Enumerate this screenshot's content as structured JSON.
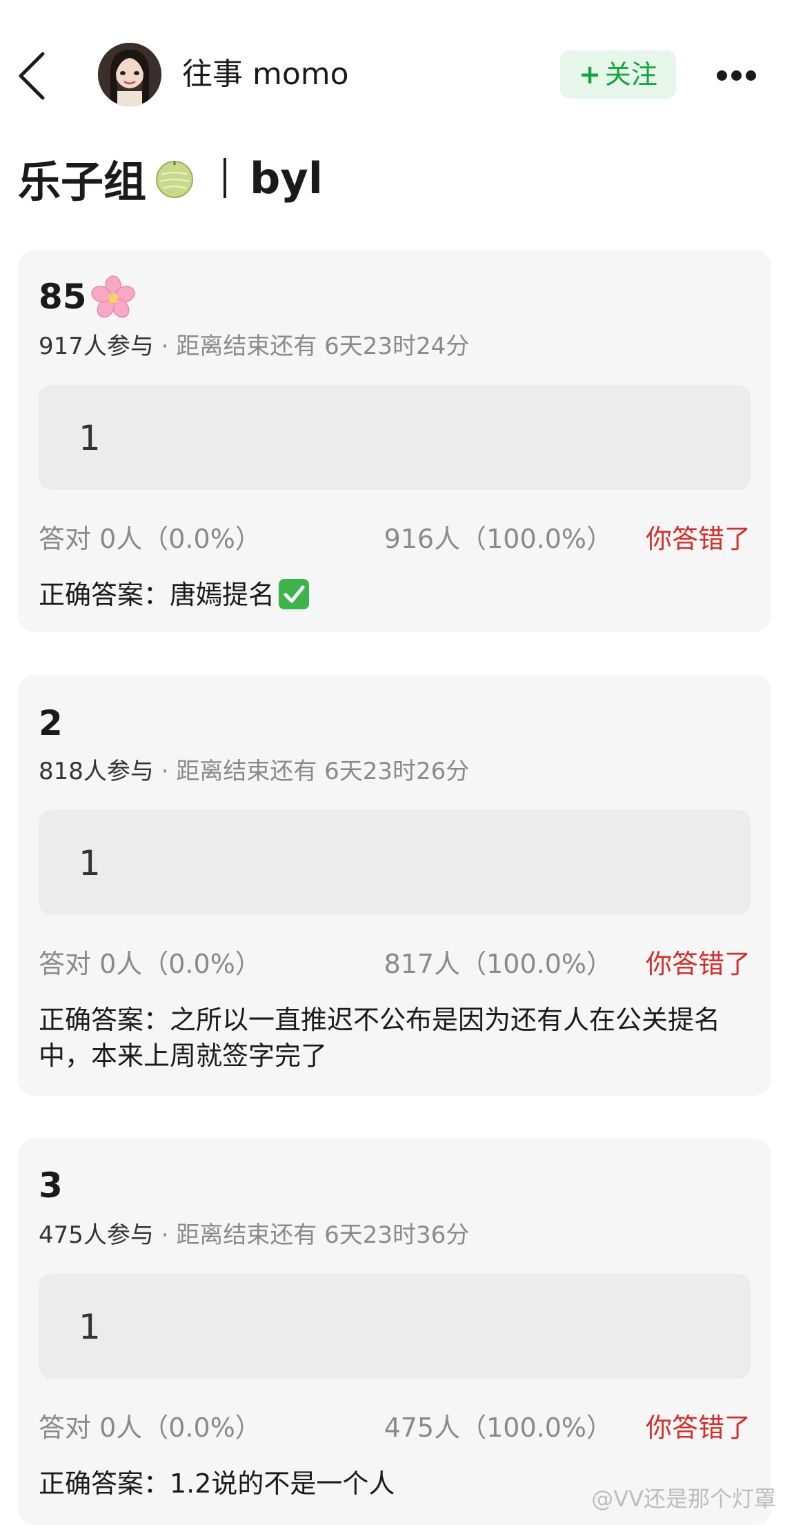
{
  "header": {
    "username": "往事 momo",
    "follow_label": "关注"
  },
  "group_title": {
    "name": "乐子组",
    "author": "byl"
  },
  "cards": [
    {
      "title": "85",
      "participants": "917人参与",
      "deadline": "· 距离结束还有 6天23时24分",
      "option": "1",
      "correct_count": "答对  0人（0.0%）",
      "other_count": "916人（100.0%）",
      "verdict": "你答错了",
      "answer": "正确答案：唐嫣提名"
    },
    {
      "title": "2",
      "participants": "818人参与",
      "deadline": "· 距离结束还有 6天23时26分",
      "option": "1",
      "correct_count": "答对  0人（0.0%）",
      "other_count": "817人（100.0%）",
      "verdict": "你答错了",
      "answer": "正确答案：之所以一直推迟不公布是因为还有人在公关提名中，本来上周就签字完了"
    },
    {
      "title": "3",
      "participants": "475人参与",
      "deadline": "· 距离结束还有 6天23时36分",
      "option": "1",
      "correct_count": "答对  0人（0.0%）",
      "other_count": "475人（100.0%）",
      "verdict": "你答错了",
      "answer": "正确答案：1.2说的不是一个人"
    }
  ],
  "watermark": "@VV还是那个灯罩",
  "colors": {
    "follow_bg": "#e6f6ea",
    "follow_text": "#13a43b",
    "wrong_text": "#d0312d",
    "card_bg": "#f6f6f6",
    "option_bg": "#ececec"
  },
  "icons": [
    "back-arrow-icon",
    "more-dots-icon",
    "melon-icon",
    "cherry-blossom-icon",
    "check-mark-icon"
  ]
}
